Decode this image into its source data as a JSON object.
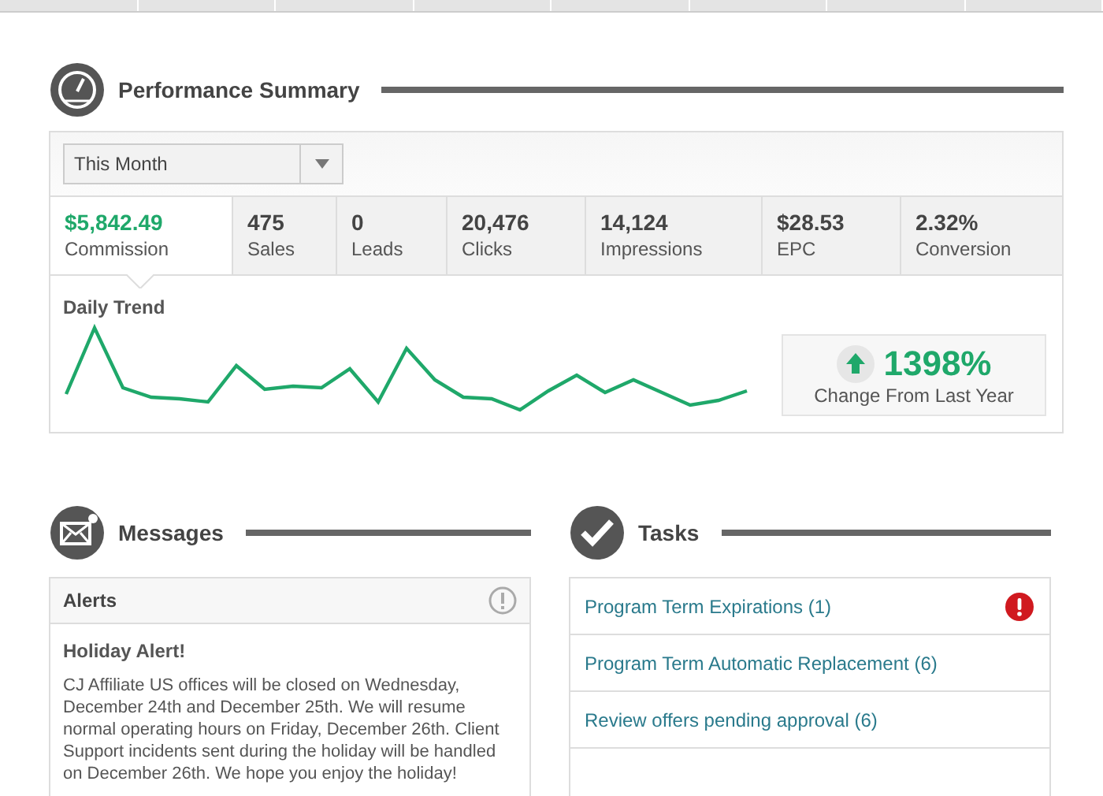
{
  "performance": {
    "title": "Performance Summary",
    "period": {
      "value": "This Month"
    },
    "stats": [
      {
        "value": "$5,842.49",
        "label": "Commission",
        "selected": true
      },
      {
        "value": "475",
        "label": "Sales",
        "selected": false
      },
      {
        "value": "0",
        "label": "Leads",
        "selected": false
      },
      {
        "value": "20,476",
        "label": "Clicks",
        "selected": false
      },
      {
        "value": "14,124",
        "label": "Impressions",
        "selected": false
      },
      {
        "value": "$28.53",
        "label": "EPC",
        "selected": false
      },
      {
        "value": "2.32%",
        "label": "Conversion",
        "selected": false
      }
    ],
    "trend": {
      "title": "Daily Trend",
      "change": "1398%",
      "change_label": "Change From Last Year",
      "rising": true
    }
  },
  "messages": {
    "title": "Messages",
    "alerts": {
      "title": "Alerts",
      "heading": "Holiday Alert!",
      "body": "CJ Affiliate US offices will be closed on Wednesday, December 24th and December 25th. We will resume normal operating hours on Friday, December 26th. Client Support incidents sent during the holiday will be handled on December 26th. We hope you enjoy the holiday!"
    }
  },
  "tasks": {
    "title": "Tasks",
    "items": [
      {
        "label": "Program Term Expirations (1)",
        "urgent": true
      },
      {
        "label": "Program Term Automatic Replacement (6)",
        "urgent": false
      },
      {
        "label": "Review offers pending approval (6)",
        "urgent": false
      }
    ]
  }
}
